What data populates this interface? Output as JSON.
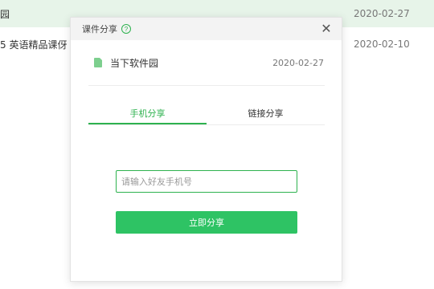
{
  "background_list": {
    "rows": [
      {
        "name": "园",
        "date": "2020-02-27"
      },
      {
        "name": "5 英语精品课伢",
        "date": "2020-02-10"
      }
    ]
  },
  "modal": {
    "title": "课件分享",
    "help_icon": "?",
    "close_icon": "✕",
    "file": {
      "icon": "file-icon",
      "name": "当下软件园",
      "date": "2020-02-27"
    },
    "tabs": [
      {
        "label": "手机分享",
        "active": true
      },
      {
        "label": "链接分享",
        "active": false
      }
    ],
    "input": {
      "placeholder": "请输入好友手机号",
      "value": ""
    },
    "submit_label": "立即分享"
  },
  "colors": {
    "accent": "#2eb24f",
    "button": "#2ec364",
    "row_highlight": "#e7f4e9"
  }
}
